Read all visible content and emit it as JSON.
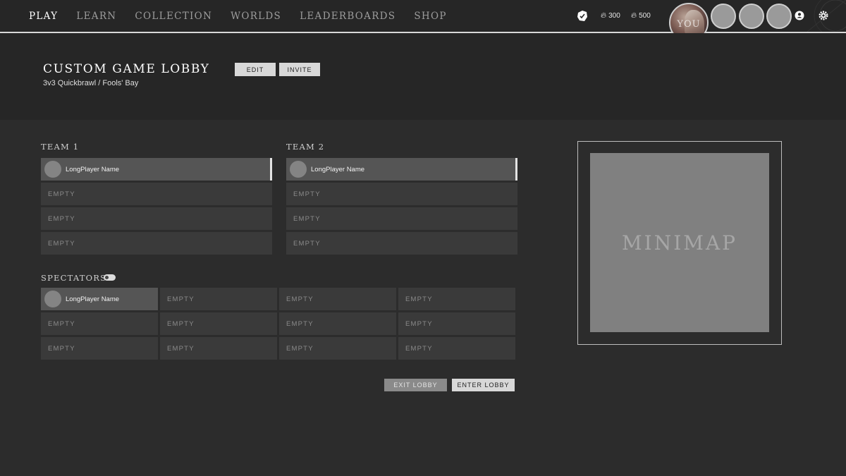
{
  "nav": {
    "items": [
      "PLAY",
      "LEARN",
      "COLLECTION",
      "WORLDS",
      "LEADERBOARDS",
      "SHOP"
    ],
    "active": "PLAY"
  },
  "hud": {
    "currency_1": "300",
    "currency_2": "500",
    "avatar_label": "YOU",
    "icons": [
      "crest-icon",
      "flame-icon",
      "friends-icon",
      "settings-icon"
    ]
  },
  "lobby": {
    "title": "CUSTOM GAME LOBBY",
    "subtitle": "3v3 Quickbrawl / Fools' Bay",
    "edit_label": "EDIT",
    "invite_label": "INVITE"
  },
  "team1": {
    "label": "TEAM 1",
    "slots": [
      "LongPlayer Name",
      "EMPTY",
      "EMPTY",
      "EMPTY"
    ]
  },
  "team2": {
    "label": "TEAM 2",
    "slots": [
      "LongPlayer Name",
      "EMPTY",
      "EMPTY",
      "EMPTY"
    ]
  },
  "spectators": {
    "label": "SPECTATORS",
    "slots": [
      "LongPlayer Name",
      "EMPTY",
      "EMPTY",
      "EMPTY",
      "EMPTY",
      "EMPTY",
      "EMPTY",
      "EMPTY",
      "EMPTY",
      "EMPTY",
      "EMPTY",
      "EMPTY"
    ]
  },
  "footer": {
    "exit_label": "EXIT LOBBY",
    "enter_label": "ENTER LOBBY"
  },
  "minimap": {
    "label": "MINIMAP"
  },
  "colors": {
    "background": "#2c2c2c",
    "header": "#262626",
    "slot_empty": "#3a3a3a",
    "slot_filled": "#555555",
    "minimap": "#808080"
  }
}
